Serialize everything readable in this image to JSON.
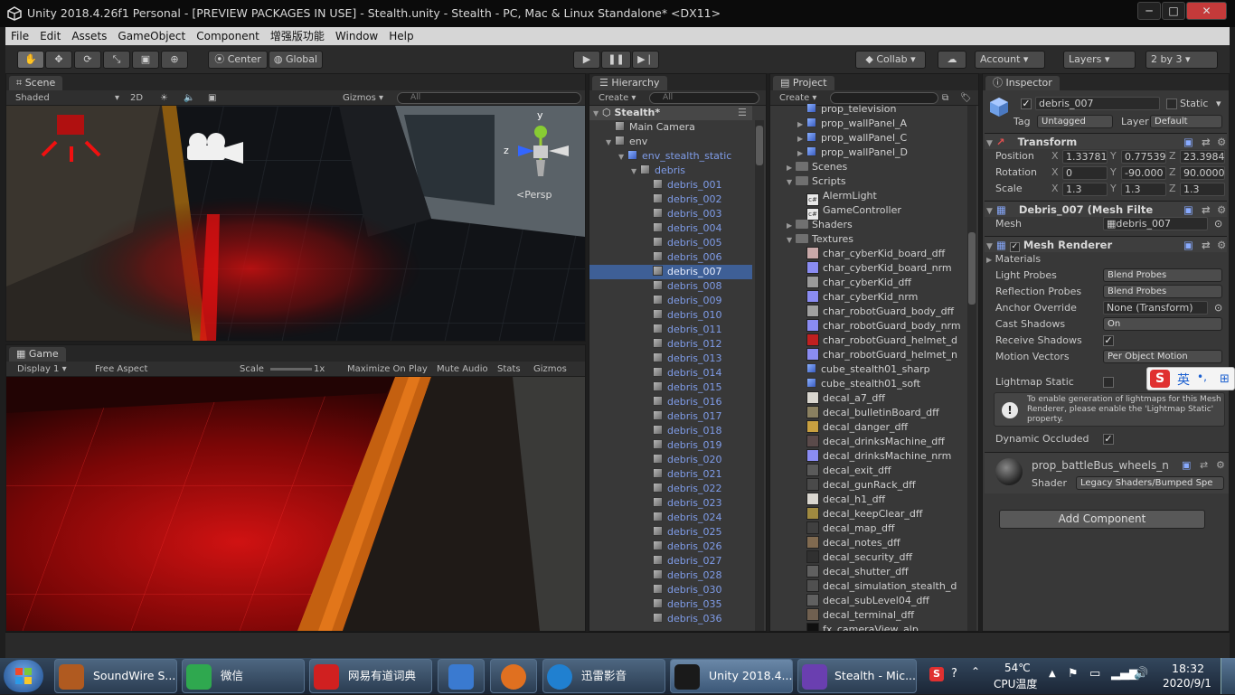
{
  "window": {
    "title": "Unity 2018.4.26f1 Personal - [PREVIEW PACKAGES IN USE] - Stealth.unity - Stealth - PC, Mac & Linux Standalone* <DX11>",
    "minimize": "─",
    "maximize": "□",
    "close": "✕"
  },
  "menu": [
    "File",
    "Edit",
    "Assets",
    "GameObject",
    "Component",
    "增强版功能",
    "Window",
    "Help"
  ],
  "toolbar": {
    "tools": [
      "hand-icon",
      "move-icon",
      "rotate-icon",
      "scale-icon",
      "rect-icon",
      "transform-icon"
    ],
    "center": "Center",
    "global": "Global",
    "play": "▶",
    "pause": "❚❚",
    "step": "▶❘",
    "collab": "Collab",
    "account": "Account",
    "layers": "Layers",
    "layout": "2 by 3"
  },
  "scene": {
    "tab": "Scene",
    "shading": "Shaded",
    "mode2d": "2D",
    "gizmos": "Gizmos",
    "search_placeholder": "All",
    "persp": "Persp",
    "axis_y": "y",
    "axis_z": "z"
  },
  "game": {
    "tab": "Game",
    "display": "Display 1",
    "aspect": "Free Aspect",
    "scale_label": "Scale",
    "scale_value": "1x",
    "maximize": "Maximize On Play",
    "mute": "Mute Audio",
    "stats": "Stats",
    "gizmos": "Gizmos"
  },
  "hierarchy": {
    "tab": "Hierarchy",
    "create": "Create",
    "search_placeholder": "All",
    "scene": "Stealth*",
    "items": [
      {
        "label": "Main Camera",
        "indent": 1,
        "icon": "grey",
        "arrow": ""
      },
      {
        "label": "env",
        "indent": 1,
        "icon": "grey",
        "arrow": "▼"
      },
      {
        "label": "env_stealth_static",
        "indent": 2,
        "icon": "blue",
        "arrow": "▼"
      },
      {
        "label": "debris",
        "indent": 3,
        "icon": "grey",
        "arrow": "▼"
      },
      {
        "label": "debris_001",
        "indent": 4,
        "icon": "grey",
        "arrow": ""
      },
      {
        "label": "debris_002",
        "indent": 4,
        "icon": "grey",
        "arrow": ""
      },
      {
        "label": "debris_003",
        "indent": 4,
        "icon": "grey",
        "arrow": ""
      },
      {
        "label": "debris_004",
        "indent": 4,
        "icon": "grey",
        "arrow": ""
      },
      {
        "label": "debris_005",
        "indent": 4,
        "icon": "grey",
        "arrow": ""
      },
      {
        "label": "debris_006",
        "indent": 4,
        "icon": "grey",
        "arrow": ""
      },
      {
        "label": "debris_007",
        "indent": 4,
        "icon": "grey",
        "arrow": "",
        "selected": true
      },
      {
        "label": "debris_008",
        "indent": 4,
        "icon": "grey",
        "arrow": ""
      },
      {
        "label": "debris_009",
        "indent": 4,
        "icon": "grey",
        "arrow": ""
      },
      {
        "label": "debris_010",
        "indent": 4,
        "icon": "grey",
        "arrow": ""
      },
      {
        "label": "debris_011",
        "indent": 4,
        "icon": "grey",
        "arrow": ""
      },
      {
        "label": "debris_012",
        "indent": 4,
        "icon": "grey",
        "arrow": ""
      },
      {
        "label": "debris_013",
        "indent": 4,
        "icon": "grey",
        "arrow": ""
      },
      {
        "label": "debris_014",
        "indent": 4,
        "icon": "grey",
        "arrow": ""
      },
      {
        "label": "debris_015",
        "indent": 4,
        "icon": "grey",
        "arrow": ""
      },
      {
        "label": "debris_016",
        "indent": 4,
        "icon": "grey",
        "arrow": ""
      },
      {
        "label": "debris_017",
        "indent": 4,
        "icon": "grey",
        "arrow": ""
      },
      {
        "label": "debris_018",
        "indent": 4,
        "icon": "grey",
        "arrow": ""
      },
      {
        "label": "debris_019",
        "indent": 4,
        "icon": "grey",
        "arrow": ""
      },
      {
        "label": "debris_020",
        "indent": 4,
        "icon": "grey",
        "arrow": ""
      },
      {
        "label": "debris_021",
        "indent": 4,
        "icon": "grey",
        "arrow": ""
      },
      {
        "label": "debris_022",
        "indent": 4,
        "icon": "grey",
        "arrow": ""
      },
      {
        "label": "debris_023",
        "indent": 4,
        "icon": "grey",
        "arrow": ""
      },
      {
        "label": "debris_024",
        "indent": 4,
        "icon": "grey",
        "arrow": ""
      },
      {
        "label": "debris_025",
        "indent": 4,
        "icon": "grey",
        "arrow": ""
      },
      {
        "label": "debris_026",
        "indent": 4,
        "icon": "grey",
        "arrow": ""
      },
      {
        "label": "debris_027",
        "indent": 4,
        "icon": "grey",
        "arrow": ""
      },
      {
        "label": "debris_028",
        "indent": 4,
        "icon": "grey",
        "arrow": ""
      },
      {
        "label": "debris_030",
        "indent": 4,
        "icon": "grey",
        "arrow": ""
      },
      {
        "label": "debris_035",
        "indent": 4,
        "icon": "grey",
        "arrow": ""
      },
      {
        "label": "debris_036",
        "indent": 4,
        "icon": "grey",
        "arrow": ""
      }
    ]
  },
  "project": {
    "tab": "Project",
    "create": "Create",
    "items": [
      {
        "label": "prop_television",
        "kind": "prefab",
        "indent": 2,
        "arrow": ""
      },
      {
        "label": "prop_wallPanel_A",
        "kind": "prefab",
        "indent": 2,
        "arrow": "▶"
      },
      {
        "label": "prop_wallPanel_C",
        "kind": "prefab",
        "indent": 2,
        "arrow": "▶"
      },
      {
        "label": "prop_wallPanel_D",
        "kind": "prefab",
        "indent": 2,
        "arrow": "▶"
      },
      {
        "label": "Scenes",
        "kind": "folder",
        "indent": 1,
        "arrow": "▶"
      },
      {
        "label": "Scripts",
        "kind": "folder",
        "indent": 1,
        "arrow": "▼"
      },
      {
        "label": "AlermLight",
        "kind": "script",
        "indent": 2,
        "arrow": ""
      },
      {
        "label": "GameController",
        "kind": "script",
        "indent": 2,
        "arrow": ""
      },
      {
        "label": "Shaders",
        "kind": "folder",
        "indent": 1,
        "arrow": "▶"
      },
      {
        "label": "Textures",
        "kind": "folder",
        "indent": 1,
        "arrow": "▼"
      },
      {
        "label": "char_cyberKid_board_dff",
        "kind": "tex",
        "color": "#c9a9a9",
        "indent": 2,
        "arrow": ""
      },
      {
        "label": "char_cyberKid_board_nrm",
        "kind": "tex",
        "color": "#8a8cf2",
        "indent": 2,
        "arrow": ""
      },
      {
        "label": "char_cyberKid_dff",
        "kind": "tex",
        "color": "#9a9a9a",
        "indent": 2,
        "arrow": ""
      },
      {
        "label": "char_cyberKid_nrm",
        "kind": "tex",
        "color": "#8a8cf2",
        "indent": 2,
        "arrow": ""
      },
      {
        "label": "char_robotGuard_body_dff",
        "kind": "tex",
        "color": "#a0a0a0",
        "indent": 2,
        "arrow": ""
      },
      {
        "label": "char_robotGuard_body_nrm",
        "kind": "tex",
        "color": "#8a8cf2",
        "indent": 2,
        "arrow": ""
      },
      {
        "label": "char_robotGuard_helmet_d",
        "kind": "tex",
        "color": "#c02020",
        "indent": 2,
        "arrow": ""
      },
      {
        "label": "char_robotGuard_helmet_n",
        "kind": "tex",
        "color": "#8a8cf2",
        "indent": 2,
        "arrow": ""
      },
      {
        "label": "cube_stealth01_sharp",
        "kind": "mesh",
        "indent": 2,
        "arrow": ""
      },
      {
        "label": "cube_stealth01_soft",
        "kind": "mesh",
        "indent": 2,
        "arrow": ""
      },
      {
        "label": "decal_a7_dff",
        "kind": "tex",
        "color": "#d9d6cf",
        "indent": 2,
        "arrow": ""
      },
      {
        "label": "decal_bulletinBoard_dff",
        "kind": "tex",
        "color": "#8a8060",
        "indent": 2,
        "arrow": ""
      },
      {
        "label": "decal_danger_dff",
        "kind": "tex",
        "color": "#c8a040",
        "indent": 2,
        "arrow": ""
      },
      {
        "label": "decal_drinksMachine_dff",
        "kind": "tex",
        "color": "#5a4a4a",
        "indent": 2,
        "arrow": ""
      },
      {
        "label": "decal_drinksMachine_nrm",
        "kind": "tex",
        "color": "#8a8cf2",
        "indent": 2,
        "arrow": ""
      },
      {
        "label": "decal_exit_dff",
        "kind": "tex",
        "color": "#5a5a5a",
        "indent": 2,
        "arrow": ""
      },
      {
        "label": "decal_gunRack_dff",
        "kind": "tex",
        "color": "#4a4a4a",
        "indent": 2,
        "arrow": ""
      },
      {
        "label": "decal_h1_dff",
        "kind": "tex",
        "color": "#d9d6cf",
        "indent": 2,
        "arrow": ""
      },
      {
        "label": "decal_keepClear_dff",
        "kind": "tex",
        "color": "#a08a40",
        "indent": 2,
        "arrow": ""
      },
      {
        "label": "decal_map_dff",
        "kind": "tex",
        "color": "#404040",
        "indent": 2,
        "arrow": ""
      },
      {
        "label": "decal_notes_dff",
        "kind": "tex",
        "color": "#806a50",
        "indent": 2,
        "arrow": ""
      },
      {
        "label": "decal_security_dff",
        "kind": "tex",
        "color": "#303030",
        "indent": 2,
        "arrow": ""
      },
      {
        "label": "decal_shutter_dff",
        "kind": "tex",
        "color": "#606060",
        "indent": 2,
        "arrow": ""
      },
      {
        "label": "decal_simulation_stealth_d",
        "kind": "tex",
        "color": "#505050",
        "indent": 2,
        "arrow": ""
      },
      {
        "label": "decal_subLevel04_dff",
        "kind": "tex",
        "color": "#606060",
        "indent": 2,
        "arrow": ""
      },
      {
        "label": "decal_terminal_dff",
        "kind": "tex",
        "color": "#706050",
        "indent": 2,
        "arrow": ""
      },
      {
        "label": "fx_cameraView_alp",
        "kind": "tex",
        "color": "#101010",
        "indent": 2,
        "arrow": ""
      }
    ]
  },
  "inspector": {
    "tab": "Inspector",
    "name": "debris_007",
    "static": "Static",
    "tag_label": "Tag",
    "tag": "Untagged",
    "layer_label": "Layer",
    "layer": "Default",
    "transform": {
      "title": "Transform",
      "position_label": "Position",
      "rotation_label": "Rotation",
      "scale_label": "Scale",
      "position": {
        "x": "1.33781",
        "y": "0.77539",
        "z": "23.3984"
      },
      "rotation": {
        "x": "0",
        "y": "-90.000",
        "z": "90.0000"
      },
      "scale": {
        "x": "1.3",
        "y": "1.3",
        "z": "1.3"
      }
    },
    "mesh_filter": {
      "title": "Debris_007 (Mesh Filte",
      "mesh_label": "Mesh",
      "mesh": "debris_007"
    },
    "mesh_renderer": {
      "title": "Mesh Renderer",
      "materials": "Materials",
      "light_probes_label": "Light Probes",
      "light_probes": "Blend Probes",
      "reflection_probes_label": "Reflection Probes",
      "reflection_probes": "Blend Probes",
      "anchor_override_label": "Anchor Override",
      "anchor_override": "None (Transform)",
      "cast_shadows_label": "Cast Shadows",
      "cast_shadows": "On",
      "receive_shadows_label": "Receive Shadows",
      "motion_vectors_label": "Motion Vectors",
      "motion_vectors": "Per Object Motion",
      "lightmap_static_label": "Lightmap Static",
      "info": "To enable generation of lightmaps for this Mesh Renderer, please enable the 'Lightmap Static' property.",
      "dynamic_occluded_label": "Dynamic Occluded"
    },
    "material": {
      "name": "prop_battleBus_wheels_n",
      "shader_label": "Shader",
      "shader": "Legacy Shaders/Bumped Spe"
    },
    "add_component": "Add Component"
  },
  "ime": {
    "s": "S",
    "lang": "英",
    "punct": "•,"
  },
  "taskbar": {
    "apps": [
      {
        "label": "SoundWire S...",
        "color": "#b05a20"
      },
      {
        "label": "微信",
        "color": "#2fa84f"
      },
      {
        "label": "网易有道词典",
        "color": "#d02020"
      },
      {
        "label": "",
        "color": "#3a7ad0"
      },
      {
        "label": "",
        "color": "#e07020"
      },
      {
        "label": "迅雷影音",
        "color": "#2080d0"
      },
      {
        "label": "Unity 2018.4....",
        "color": "#1a1a1a"
      },
      {
        "label": "Stealth - Mic...",
        "color": "#6a3fb0"
      }
    ],
    "temp": "54℃",
    "cpu": "CPU温度",
    "time": "18:32",
    "date": "2020/9/1"
  }
}
